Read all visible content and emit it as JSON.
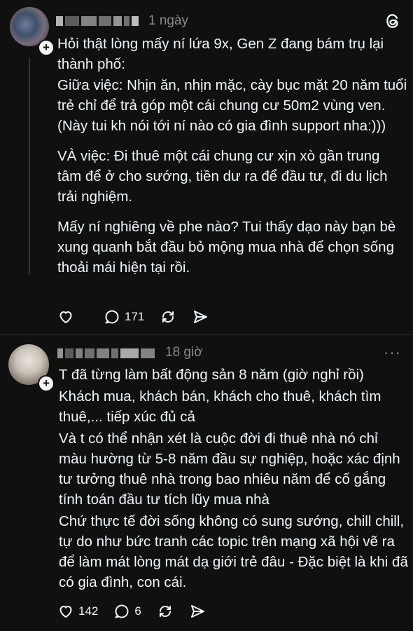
{
  "post1": {
    "time": "1 ngày",
    "paragraphs": [
      "Hỏi thật lòng mấy ní lứa 9x, Gen Z đang bám trụ lại thành phố:",
      "Giữa việc: Nhịn ăn, nhịn mặc, cày bục mặt 20 năm tuổi trẻ chỉ để trả góp một cái chung cư 50m2 vùng ven. (Này tui kh nói tới ní nào có gia đình support nha:)))",
      "VÀ việc: Đi thuê một cái chung cư xịn xò gần trung tâm để ở cho sướng, tiền dư ra để đầu tư, đi du lịch trải nghiệm.",
      "Mấy ní nghiêng về phe nào? Tui thấy dạo này bạn bè xung quanh bắt đầu bỏ mộng mua nhà để chọn sống thoải mái hiện tại rồi."
    ],
    "replies": "171",
    "follow_symbol": "+"
  },
  "post2": {
    "time": "18 giờ",
    "paragraphs": [
      "T đã từng làm bất động sản 8 năm (giờ nghỉ rồi)",
      "Khách mua, khách bán, khách cho thuê, khách tìm thuê,... tiếp xúc đủ cả",
      "Và t có thể nhận xét là cuộc đời đi thuê nhà nó chỉ màu hường từ 5-8 năm đầu sự nghiệp, hoặc xác định tư tưởng thuê nhà trong bao nhiêu năm để cố gắng tính toán đầu tư tích lũy mua nhà",
      "Chứ thực tế đời sống không có sung sướng, chill chill, tự do như bức tranh các topic trên mạng xã hội vẽ ra để làm mát lòng mát dạ giới trẻ đâu - Đặc biệt là khi đã có gia đình, con cái."
    ],
    "likes": "142",
    "replies": "6",
    "follow_symbol": "+",
    "more": "···"
  },
  "icons": [
    "heart-icon",
    "comment-icon",
    "repost-icon",
    "share-icon",
    "threads-logo-icon",
    "more-icon"
  ]
}
